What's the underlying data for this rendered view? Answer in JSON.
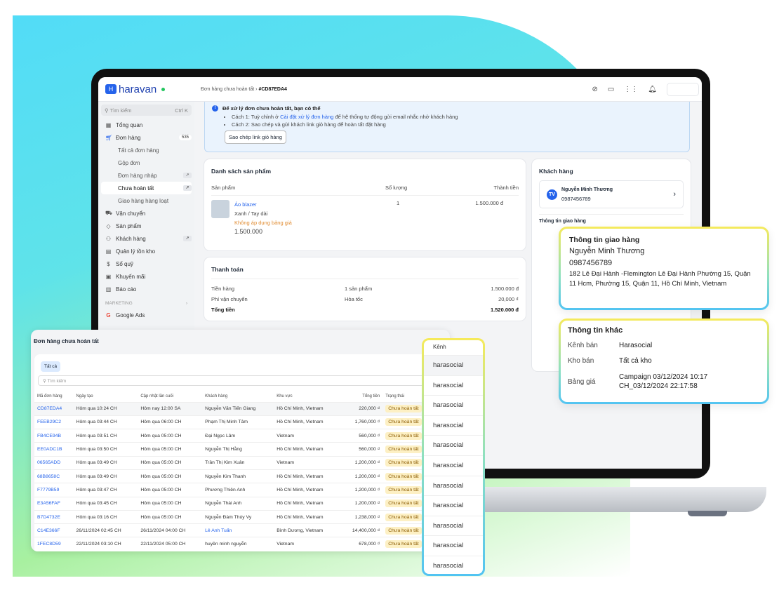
{
  "header": {
    "logo": "haravan",
    "breadcrumb_parent": "Đơn hàng chưa hoàn tất",
    "breadcrumb_current": "#CD87EDA4",
    "icons": [
      "help-icon",
      "feedback-icon",
      "apps-grid-icon",
      "bell-icon"
    ]
  },
  "sidebar": {
    "search_placeholder": "Tìm kiếm",
    "search_shortcut": "Ctrl K",
    "items": [
      {
        "label": "Tổng quan",
        "icon": "dashboard-icon"
      },
      {
        "label": "Đơn hàng",
        "icon": "cart-icon",
        "badge": "535"
      },
      {
        "label": "Tất cả đơn hàng"
      },
      {
        "label": "Gộp đơn"
      },
      {
        "label": "Đơn hàng nháp"
      },
      {
        "label": "Chưa hoàn tất",
        "active": true
      },
      {
        "label": "Giao hàng hàng loạt"
      },
      {
        "label": "Vận chuyển",
        "icon": "truck-icon"
      },
      {
        "label": "Sản phẩm",
        "icon": "tag-icon"
      },
      {
        "label": "Khách hàng",
        "icon": "users-icon"
      },
      {
        "label": "Quản lý tồn kho",
        "icon": "archive-icon"
      },
      {
        "label": "Sổ quỹ",
        "icon": "dollar-icon"
      },
      {
        "label": "Khuyến mãi",
        "icon": "gift-icon"
      },
      {
        "label": "Báo cáo",
        "icon": "chart-icon"
      }
    ],
    "section": "MARKETING",
    "google_ads": "Google Ads"
  },
  "banner": {
    "title": "Để xử lý đơn chưa hoàn tất, bạn có thể",
    "line1_prefix": "Cách 1: Tuỳ chỉnh ở ",
    "line1_link": "Cài đặt xử lý đơn hàng",
    "line1_suffix": " để hệ thống tự động gửi email nhắc nhở khách hàng",
    "line2": "Cách 2: Sao chép và gửi khách link giỏ hàng để hoàn tất đặt hàng",
    "button": "Sao chép link giỏ hàng"
  },
  "products": {
    "title": "Danh sách sản phẩm",
    "col_product": "Sản phẩm",
    "col_qty": "Số lượng",
    "col_total": "Thành tiền",
    "item": {
      "name": "Áo blazer",
      "variant": "Xanh / Tay dài",
      "note": "Không áp dụng bảng giá",
      "price": "1.500.000",
      "qty": "1",
      "total": "1.500.000 đ"
    }
  },
  "payment": {
    "title": "Thanh toán",
    "rows": [
      {
        "label": "Tiền hàng",
        "mid": "1 sản phẩm",
        "value": "1.500.000 đ"
      },
      {
        "label": "Phí vận chuyển",
        "mid": "Hỏa tốc",
        "value": "20,000 ₫"
      }
    ],
    "total_label": "Tổng tiền",
    "total_value": "1.520.000 đ"
  },
  "customer": {
    "title": "Khách hàng",
    "initials": "TV",
    "name": "Nguyễn Minh Thương",
    "phone": "0987456789",
    "shipping_label": "Thông tin giao hàng"
  },
  "shipping_popup": {
    "title": "Thông tin giao hàng",
    "name": "Nguyễn Minh Thương",
    "phone": "0987456789",
    "address": "182 Lê Đại Hành -Flemington Lê Đại Hành Phường 15, Quận 11 Hcm, Phường 15, Quận 11, Hồ Chí Minh, Vietnam"
  },
  "other_popup": {
    "title": "Thông tin khác",
    "rows": [
      {
        "label": "Kênh bán",
        "value": "Harasocial"
      },
      {
        "label": "Kho bán",
        "value": "Tất cả kho"
      },
      {
        "label": "Bảng giá",
        "value": "Campaign 03/12/2024 10:17 CH_03/12/2024 22:17:58"
      }
    ]
  },
  "orders": {
    "title": "Đơn hàng chưa hoàn tất",
    "tab": "Tất cả",
    "search_placeholder": "Tìm kiếm",
    "columns": [
      "Mã đơn hàng",
      "Ngày tạo",
      "Cập nhật lần cuối",
      "Khách hàng",
      "Khu vực",
      "Tổng tiền",
      "Trạng thái",
      "Kênh"
    ],
    "rows": [
      [
        "CD87EDA4",
        "Hôm qua 10:24 CH",
        "Hôm nay 12:00 SA",
        "Nguyễn Văn Tiến Giang",
        "Hồ Chí Minh, Vietnam",
        "220,000 ₫",
        "Chưa hoàn tất",
        "hara"
      ],
      [
        "FEEB29C2",
        "Hôm qua 03:44 CH",
        "Hôm qua 06:00 CH",
        "Phạm Thị Minh Tâm",
        "Hồ Chí Minh, Vietnam",
        "1,760,000 ₫",
        "Chưa hoàn tất",
        "hara"
      ],
      [
        "FB4CE94B",
        "Hôm qua 03:51 CH",
        "Hôm qua 05:00 CH",
        "Đại Ngọc Lâm",
        "Vietnam",
        "560,000 ₫",
        "Chưa hoàn tất",
        "hara"
      ],
      [
        "EE0ADC1B",
        "Hôm qua 03:50 CH",
        "Hôm qua 05:00 CH",
        "Nguyễn Thị Hằng",
        "Hồ Chí Minh, Vietnam",
        "560,000 ₫",
        "Chưa hoàn tất",
        "hara"
      ],
      [
        "06565ADD",
        "Hôm qua 03:49 CH",
        "Hôm qua 05:00 CH",
        "Trần Thị Kim Xuân",
        "Vietnam",
        "1,200,000 ₫",
        "Chưa hoàn tất",
        "hara"
      ],
      [
        "68B8658C",
        "Hôm qua 03:49 CH",
        "Hôm qua 05:00 CH",
        "Nguyễn Kim Thanh",
        "Hồ Chí Minh, Vietnam",
        "1,200,000 ₫",
        "Chưa hoàn tất",
        "hara"
      ],
      [
        "F7779B59",
        "Hôm qua 03:47 CH",
        "Hôm qua 05:00 CH",
        "Phương Thiên Anh",
        "Hồ Chí Minh, Vietnam",
        "1,200,000 ₫",
        "Chưa hoàn tất",
        "hara"
      ],
      [
        "E3A56FAF",
        "Hôm qua 03:45 CH",
        "Hôm qua 05:00 CH",
        "Nguyễn Thái Anh",
        "Hồ Chí Minh, Vietnam",
        "1,200,000 ₫",
        "Chưa hoàn tất",
        "hara"
      ],
      [
        "B7D4732E",
        "Hôm qua 03:16 CH",
        "Hôm qua 05:00 CH",
        "Nguyễn Đàm Thúy Vy",
        "Hồ Chí Minh, Vietnam",
        "1,238,000 ₫",
        "Chưa hoàn tất",
        "hara"
      ],
      [
        "C14E366F",
        "26/11/2024 02:45 CH",
        "26/11/2024 04:00 CH",
        "Lê Anh Tuấn",
        "Bình Dương, Vietnam",
        "14,400,000 ₫",
        "Chưa hoàn tất",
        "hara"
      ],
      [
        "1FEC8D59",
        "22/11/2024 03:10 CH",
        "22/11/2024 05:00 CH",
        "huyền minh nguyễn",
        "Vietnam",
        "678,000 ₫",
        "Chưa hoàn tất",
        "hara"
      ]
    ]
  },
  "channel_popup": {
    "header": "Kênh",
    "values": [
      "harasocial",
      "harasocial",
      "harasocial",
      "harasocial",
      "harasocial",
      "harasocial",
      "harasocial",
      "harasocial",
      "harasocial",
      "harasocial",
      "harasocial"
    ]
  }
}
